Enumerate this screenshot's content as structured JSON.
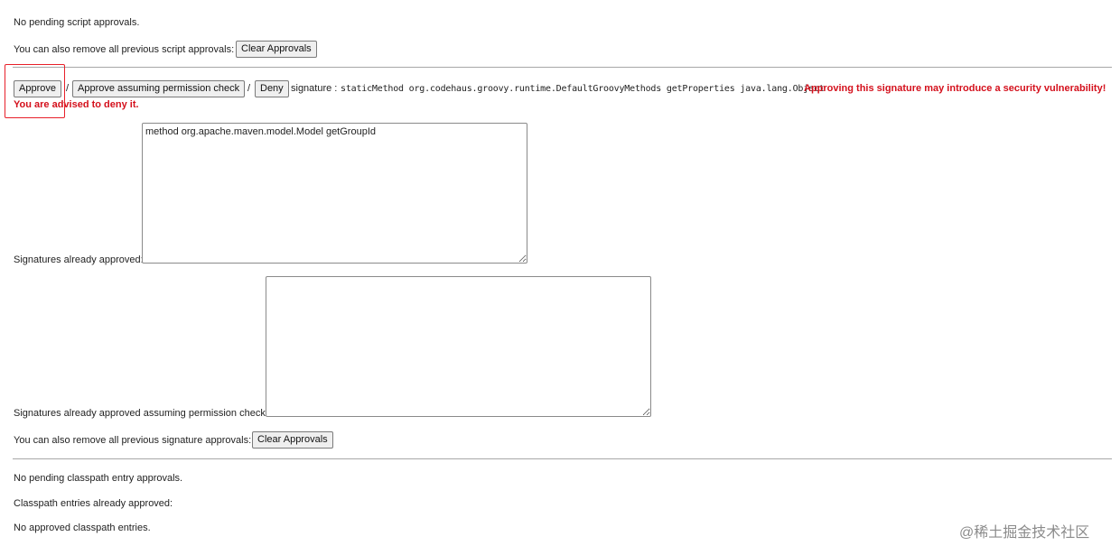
{
  "script_approvals": {
    "pending_text": "No pending script approvals.",
    "remove_all_label": "You can also remove all previous script approvals:",
    "clear_button": "Clear Approvals"
  },
  "signature_approval": {
    "approve_button": "Approve",
    "separator": "/",
    "approve_assuming_button": "Approve assuming permission check",
    "deny_button": "Deny",
    "signature_prefix": "signature :",
    "signature_value": "staticMethod org.codehaus.groovy.runtime.DefaultGroovyMethods getProperties java.lang.Object",
    "warning_line1": "Approving this signature may introduce a security vulnerability!",
    "warning_line2": "You are advised to deny it."
  },
  "signatures": {
    "approved_label": "Signatures already approved:",
    "approved_value": "method org.apache.maven.model.Model getGroupId",
    "approved_assuming_label": "Signatures already approved assuming permission check:",
    "approved_assuming_value": "",
    "remove_all_label": "You can also remove all previous signature approvals:",
    "clear_button": "Clear Approvals"
  },
  "classpath": {
    "pending_text": "No pending classpath entry approvals.",
    "approved_label": "Classpath entries already approved:",
    "none_text": "No approved classpath entries."
  },
  "watermark": "@稀土掘金技术社区",
  "colors": {
    "warning": "#d4101c",
    "highlight_box": "#e8202a",
    "divider": "#a8a8a8"
  }
}
